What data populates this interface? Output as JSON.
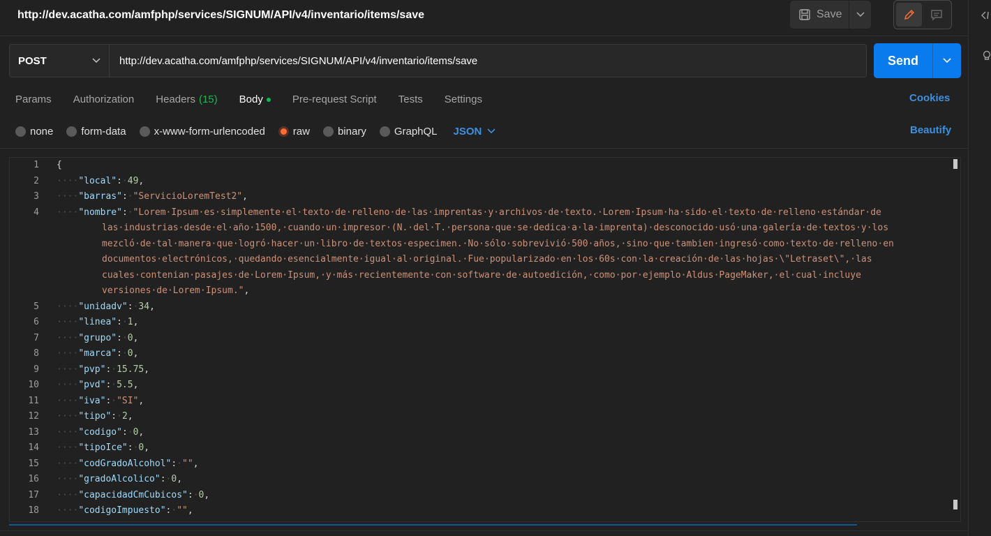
{
  "header": {
    "title": "http://dev.acatha.com/amfphp/services/SIGNUM/API/v4/inventario/items/save",
    "save_label": "Save"
  },
  "request": {
    "method": "POST",
    "url": "http://dev.acatha.com/amfphp/services/SIGNUM/API/v4/inventario/items/save",
    "send_label": "Send"
  },
  "tabs": [
    {
      "label": "Params"
    },
    {
      "label": "Authorization"
    },
    {
      "label": "Headers",
      "count": "(15)"
    },
    {
      "label": "Body",
      "active": true
    },
    {
      "label": "Pre-request Script"
    },
    {
      "label": "Tests"
    },
    {
      "label": "Settings"
    }
  ],
  "cookies_label": "Cookies",
  "body_types": [
    {
      "label": "none",
      "checked": false
    },
    {
      "label": "form-data",
      "checked": false
    },
    {
      "label": "x-www-form-urlencoded",
      "checked": false
    },
    {
      "label": "raw",
      "checked": true
    },
    {
      "label": "binary",
      "checked": false
    },
    {
      "label": "GraphQL",
      "checked": false
    }
  ],
  "language": "JSON",
  "beautify_label": "Beautify",
  "colors": {
    "accent": "#097bed",
    "link": "#3d8fe0",
    "active_dot": "#0cbb52",
    "radio_checked": "#ff6c37"
  },
  "editor": {
    "lines": [
      {
        "n": "1",
        "parts": [
          [
            "p",
            "{"
          ]
        ]
      },
      {
        "n": "2",
        "parts": [
          [
            "ind",
            "····"
          ],
          [
            "k",
            "\"local\""
          ],
          [
            "p",
            ":"
          ],
          [
            "ind",
            "·"
          ],
          [
            "n",
            "49"
          ],
          [
            "p",
            ","
          ]
        ]
      },
      {
        "n": "3",
        "parts": [
          [
            "ind",
            "····"
          ],
          [
            "k",
            "\"barras\""
          ],
          [
            "p",
            ":"
          ],
          [
            "ind",
            "·"
          ],
          [
            "s",
            "\"ServicioLoremTest2\""
          ],
          [
            "p",
            ","
          ]
        ]
      },
      {
        "n": "4",
        "parts": [
          [
            "ind",
            "····"
          ],
          [
            "k",
            "\"nombre\""
          ],
          [
            "p",
            ":"
          ],
          [
            "ind",
            "·"
          ],
          [
            "s",
            "\"Lorem·Ipsum·es·simplemente·el·texto·de·relleno·de·las·imprentas·y·archivos·de·texto.·Lorem·Ipsum·ha·sido·el·texto·de·relleno·estándar·de"
          ]
        ]
      },
      {
        "n": "",
        "wrap": true,
        "parts": [
          [
            "s",
            "las·industrias·desde·el·año·1500,·cuando·un·impresor·(N.·del·T.·persona·que·se·dedica·a·la·imprenta)·desconocido·usó·una·galería·de·textos·y·los"
          ]
        ]
      },
      {
        "n": "",
        "wrap": true,
        "parts": [
          [
            "s",
            "mezcló·de·tal·manera·que·logró·hacer·un·libro·de·textos·especimen.·No·sólo·sobrevivió·500·años,·sino·que·tambien·ingresó·como·texto·de·relleno·en"
          ]
        ]
      },
      {
        "n": "",
        "wrap": true,
        "parts": [
          [
            "s",
            "documentos·electrónicos,·quedando·esencialmente·igual·al·original.·Fue·popularizado·en·los·60s·con·la·creación·de·las·hojas·\\\"Letraset\\\",·las"
          ]
        ]
      },
      {
        "n": "",
        "wrap": true,
        "parts": [
          [
            "s",
            "cuales·contenian·pasajes·de·Lorem·Ipsum,·y·más·recientemente·con·software·de·autoedición,·como·por·ejemplo·Aldus·PageMaker,·el·cual·incluye"
          ]
        ]
      },
      {
        "n": "",
        "wrap": true,
        "parts": [
          [
            "s",
            "versiones·de·Lorem·Ipsum.\""
          ],
          [
            "p",
            ","
          ]
        ]
      },
      {
        "n": "5",
        "parts": [
          [
            "ind",
            "····"
          ],
          [
            "k",
            "\"unidadv\""
          ],
          [
            "p",
            ":"
          ],
          [
            "ind",
            "·"
          ],
          [
            "n",
            "34"
          ],
          [
            "p",
            ","
          ]
        ]
      },
      {
        "n": "6",
        "parts": [
          [
            "ind",
            "····"
          ],
          [
            "k",
            "\"linea\""
          ],
          [
            "p",
            ":"
          ],
          [
            "ind",
            "·"
          ],
          [
            "n",
            "1"
          ],
          [
            "p",
            ","
          ]
        ]
      },
      {
        "n": "7",
        "parts": [
          [
            "ind",
            "····"
          ],
          [
            "k",
            "\"grupo\""
          ],
          [
            "p",
            ":"
          ],
          [
            "ind",
            "·"
          ],
          [
            "n",
            "0"
          ],
          [
            "p",
            ","
          ]
        ]
      },
      {
        "n": "8",
        "parts": [
          [
            "ind",
            "····"
          ],
          [
            "k",
            "\"marca\""
          ],
          [
            "p",
            ":"
          ],
          [
            "ind",
            "·"
          ],
          [
            "n",
            "0"
          ],
          [
            "p",
            ","
          ]
        ]
      },
      {
        "n": "9",
        "parts": [
          [
            "ind",
            "····"
          ],
          [
            "k",
            "\"pvp\""
          ],
          [
            "p",
            ":"
          ],
          [
            "ind",
            "·"
          ],
          [
            "n",
            "15.75"
          ],
          [
            "p",
            ","
          ]
        ]
      },
      {
        "n": "10",
        "parts": [
          [
            "ind",
            "····"
          ],
          [
            "k",
            "\"pvd\""
          ],
          [
            "p",
            ":"
          ],
          [
            "ind",
            "·"
          ],
          [
            "n",
            "5.5"
          ],
          [
            "p",
            ","
          ]
        ]
      },
      {
        "n": "11",
        "parts": [
          [
            "ind",
            "····"
          ],
          [
            "k",
            "\"iva\""
          ],
          [
            "p",
            ":"
          ],
          [
            "ind",
            "·"
          ],
          [
            "s",
            "\"SI\""
          ],
          [
            "p",
            ","
          ]
        ]
      },
      {
        "n": "12",
        "parts": [
          [
            "ind",
            "····"
          ],
          [
            "k",
            "\"tipo\""
          ],
          [
            "p",
            ":"
          ],
          [
            "ind",
            "·"
          ],
          [
            "n",
            "2"
          ],
          [
            "p",
            ","
          ]
        ]
      },
      {
        "n": "13",
        "parts": [
          [
            "ind",
            "····"
          ],
          [
            "k",
            "\"codigo\""
          ],
          [
            "p",
            ":"
          ],
          [
            "ind",
            "·"
          ],
          [
            "n",
            "0"
          ],
          [
            "p",
            ","
          ]
        ]
      },
      {
        "n": "14",
        "parts": [
          [
            "ind",
            "····"
          ],
          [
            "k",
            "\"tipoIce\""
          ],
          [
            "p",
            ":"
          ],
          [
            "ind",
            "·"
          ],
          [
            "n",
            "0"
          ],
          [
            "p",
            ","
          ]
        ]
      },
      {
        "n": "15",
        "parts": [
          [
            "ind",
            "····"
          ],
          [
            "k",
            "\"codGradoAlcohol\""
          ],
          [
            "p",
            ":"
          ],
          [
            "ind",
            "·"
          ],
          [
            "s",
            "\"\""
          ],
          [
            "p",
            ","
          ]
        ]
      },
      {
        "n": "16",
        "parts": [
          [
            "ind",
            "····"
          ],
          [
            "k",
            "\"gradoAlcolico\""
          ],
          [
            "p",
            ":"
          ],
          [
            "ind",
            "·"
          ],
          [
            "n",
            "0"
          ],
          [
            "p",
            ","
          ]
        ]
      },
      {
        "n": "17",
        "parts": [
          [
            "ind",
            "····"
          ],
          [
            "k",
            "\"capacidadCmCubicos\""
          ],
          [
            "p",
            ":"
          ],
          [
            "ind",
            "·"
          ],
          [
            "n",
            "0"
          ],
          [
            "p",
            ","
          ]
        ]
      },
      {
        "n": "18",
        "parts": [
          [
            "ind",
            "····"
          ],
          [
            "k",
            "\"codigoImpuesto\""
          ],
          [
            "p",
            ":"
          ],
          [
            "ind",
            "·"
          ],
          [
            "s",
            "\"\""
          ],
          [
            "p",
            ","
          ]
        ]
      }
    ]
  }
}
